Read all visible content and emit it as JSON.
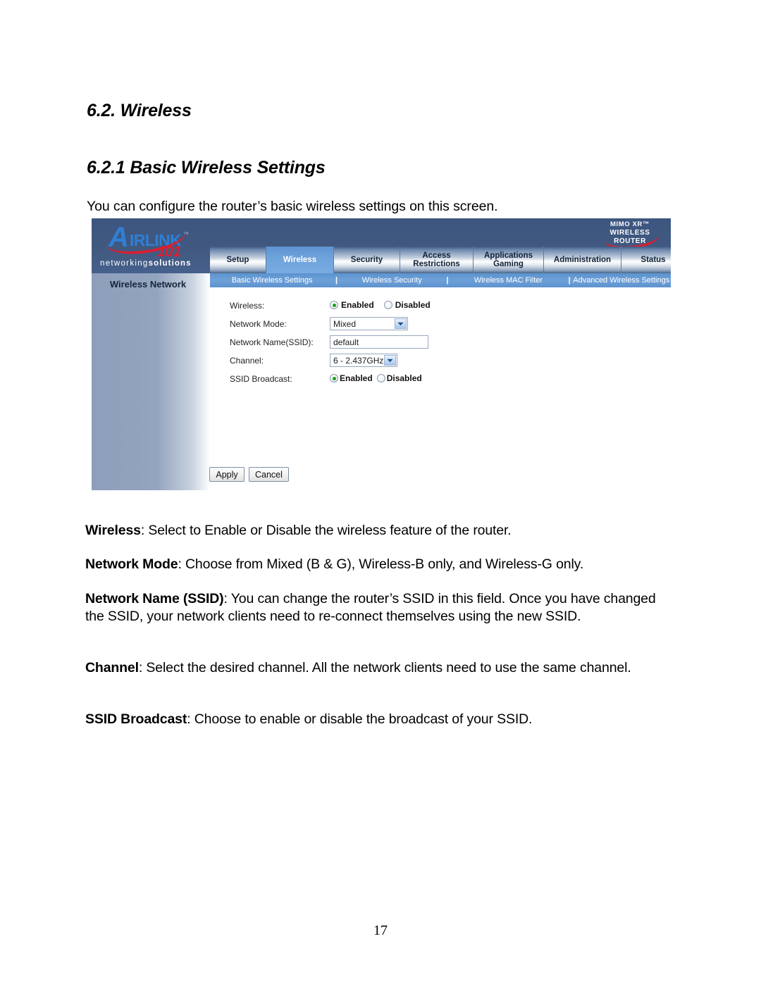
{
  "document": {
    "heading_1": "6.2. Wireless",
    "heading_2": "6.2.1 Basic Wireless Settings",
    "intro": "You can configure the router’s basic wireless settings on this screen.",
    "page_number": "17",
    "paragraphs": [
      {
        "term": "Wireless",
        "text": ": Select to Enable or Disable the wireless feature of the router."
      },
      {
        "term": "Network Mode",
        "text": ": Choose from Mixed (B & G), Wireless-B only, and Wireless-G only."
      },
      {
        "term": "Network Name (SSID)",
        "text": ": You can change the router’s SSID in this field. Once you have changed the SSID, your network clients need to re-connect themselves using the new SSID."
      },
      {
        "term": "Channel",
        "text": ": Select the desired channel. All the network clients need to use the same channel."
      },
      {
        "term": "SSID Broadcast",
        "text": ": Choose to enable or disable the broadcast of your SSID."
      }
    ]
  },
  "router_ui": {
    "logo": {
      "initial": "A",
      "wordmark": "IRLINK",
      "trademark": "™",
      "model": "101",
      "tagline_light": "networking",
      "tagline_bold": "solutions"
    },
    "product_badge": {
      "line1": "MIMO XR™",
      "line2": "WIRELESS ROUTER"
    },
    "tabs": [
      {
        "label": "Setup",
        "active": false
      },
      {
        "label": "Wireless",
        "active": true
      },
      {
        "label": "Security",
        "active": false
      },
      {
        "label": "Access\nRestrictions",
        "active": false
      },
      {
        "label": "Applications\nGaming",
        "active": false
      },
      {
        "label": "Administration",
        "active": false
      },
      {
        "label": "Status",
        "active": false
      }
    ],
    "tab_labels": {
      "setup": "Setup",
      "wireless": "Wireless",
      "security": "Security",
      "access_line1": "Access",
      "access_line2": "Restrictions",
      "apps_line1": "Applications",
      "apps_line2": "Gaming",
      "administration": "Administration",
      "status": "Status"
    },
    "subnav": {
      "separator": "|",
      "items": [
        "Basic Wireless Settings",
        "Wireless Security",
        "Wireless MAC Filter",
        "Advanced Wireless Settings"
      ]
    },
    "sidebar": {
      "title": "Wireless Network"
    },
    "form": {
      "wireless": {
        "label": "Wireless:",
        "enabled_label": "Enabled",
        "disabled_label": "Disabled",
        "selected": "Enabled"
      },
      "network_mode": {
        "label": "Network Mode:",
        "value": "Mixed",
        "options": [
          "Mixed",
          "Wireless-B Only",
          "Wireless-G Only"
        ]
      },
      "network_name": {
        "label": "Network Name(SSID):",
        "value": "default"
      },
      "channel": {
        "label": "Channel:",
        "value": "6 - 2.437GHz"
      },
      "ssid_broadcast": {
        "label": "SSID Broadcast:",
        "enabled_label": "Enabled",
        "disabled_label": "Disabled",
        "selected": "Enabled"
      }
    },
    "buttons": {
      "apply": "Apply",
      "cancel": "Cancel"
    },
    "colors": {
      "header_blue": "#41597f",
      "active_tab_blue": "#6ea2db",
      "subnav_blue": "#6ea0d8",
      "logo_blue": "#2f7fd4",
      "logo_red": "#e11d2e",
      "radio_green": "#18a018"
    }
  }
}
